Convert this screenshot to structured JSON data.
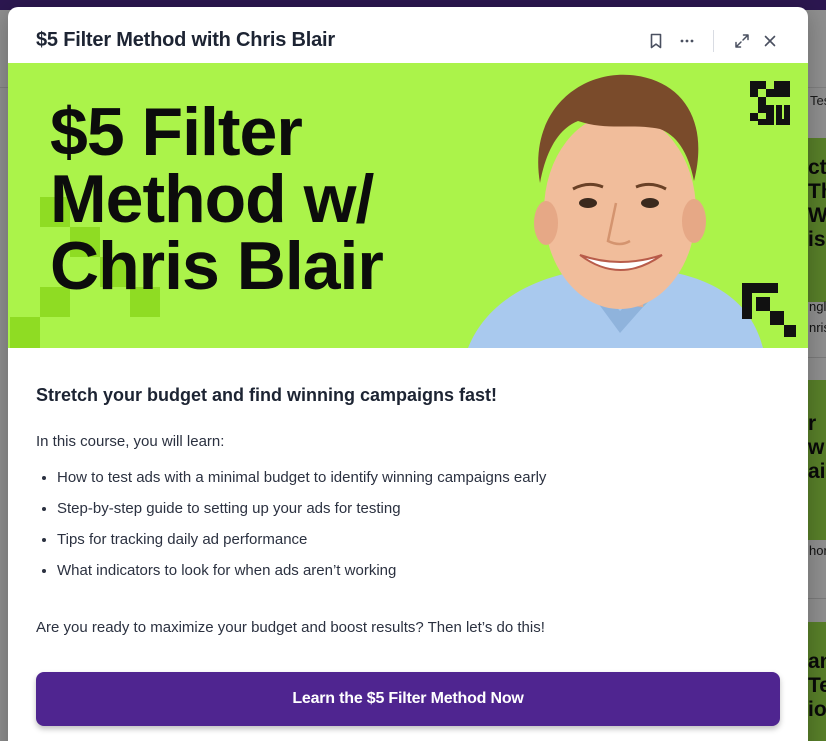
{
  "background": {
    "tab_partial": "Tes",
    "cards": [
      {
        "thumb_lines": [
          "ct",
          "Th",
          "W",
          "is"
        ],
        "text_lines": [
          "ngle",
          "nris"
        ]
      },
      {
        "thumb_lines": [
          "r",
          "w",
          "air"
        ],
        "text_lines": [
          "hor"
        ]
      },
      {
        "thumb_lines": [
          "and",
          "Te",
          "io"
        ],
        "text_lines": []
      }
    ]
  },
  "modal": {
    "title": "$5 Filter Method with Chris Blair",
    "header_icons": [
      "bookmark-icon",
      "more-icon",
      "expand-icon",
      "close-icon"
    ]
  },
  "hero": {
    "heading_lines": [
      "$5 Filter",
      "Method w/",
      "Chris Blair"
    ],
    "logo": "qodu-logo",
    "background_color": "#abf34a"
  },
  "content": {
    "subtitle": "Stretch your budget and find winning campaigns fast!",
    "intro": "In this course, you will learn:",
    "items": [
      "How to test ads with a minimal budget to identify winning campaigns early",
      "Step-by-step guide to setting up your ads for testing",
      "Tips for tracking daily ad performance",
      "What indicators to look for when ads aren’t working"
    ],
    "cta_text": "Are you ready to maximize your budget and boost results? Then let’s do this!",
    "button_label": "Learn the $5 Filter Method Now",
    "button_color": "#4f2590"
  }
}
